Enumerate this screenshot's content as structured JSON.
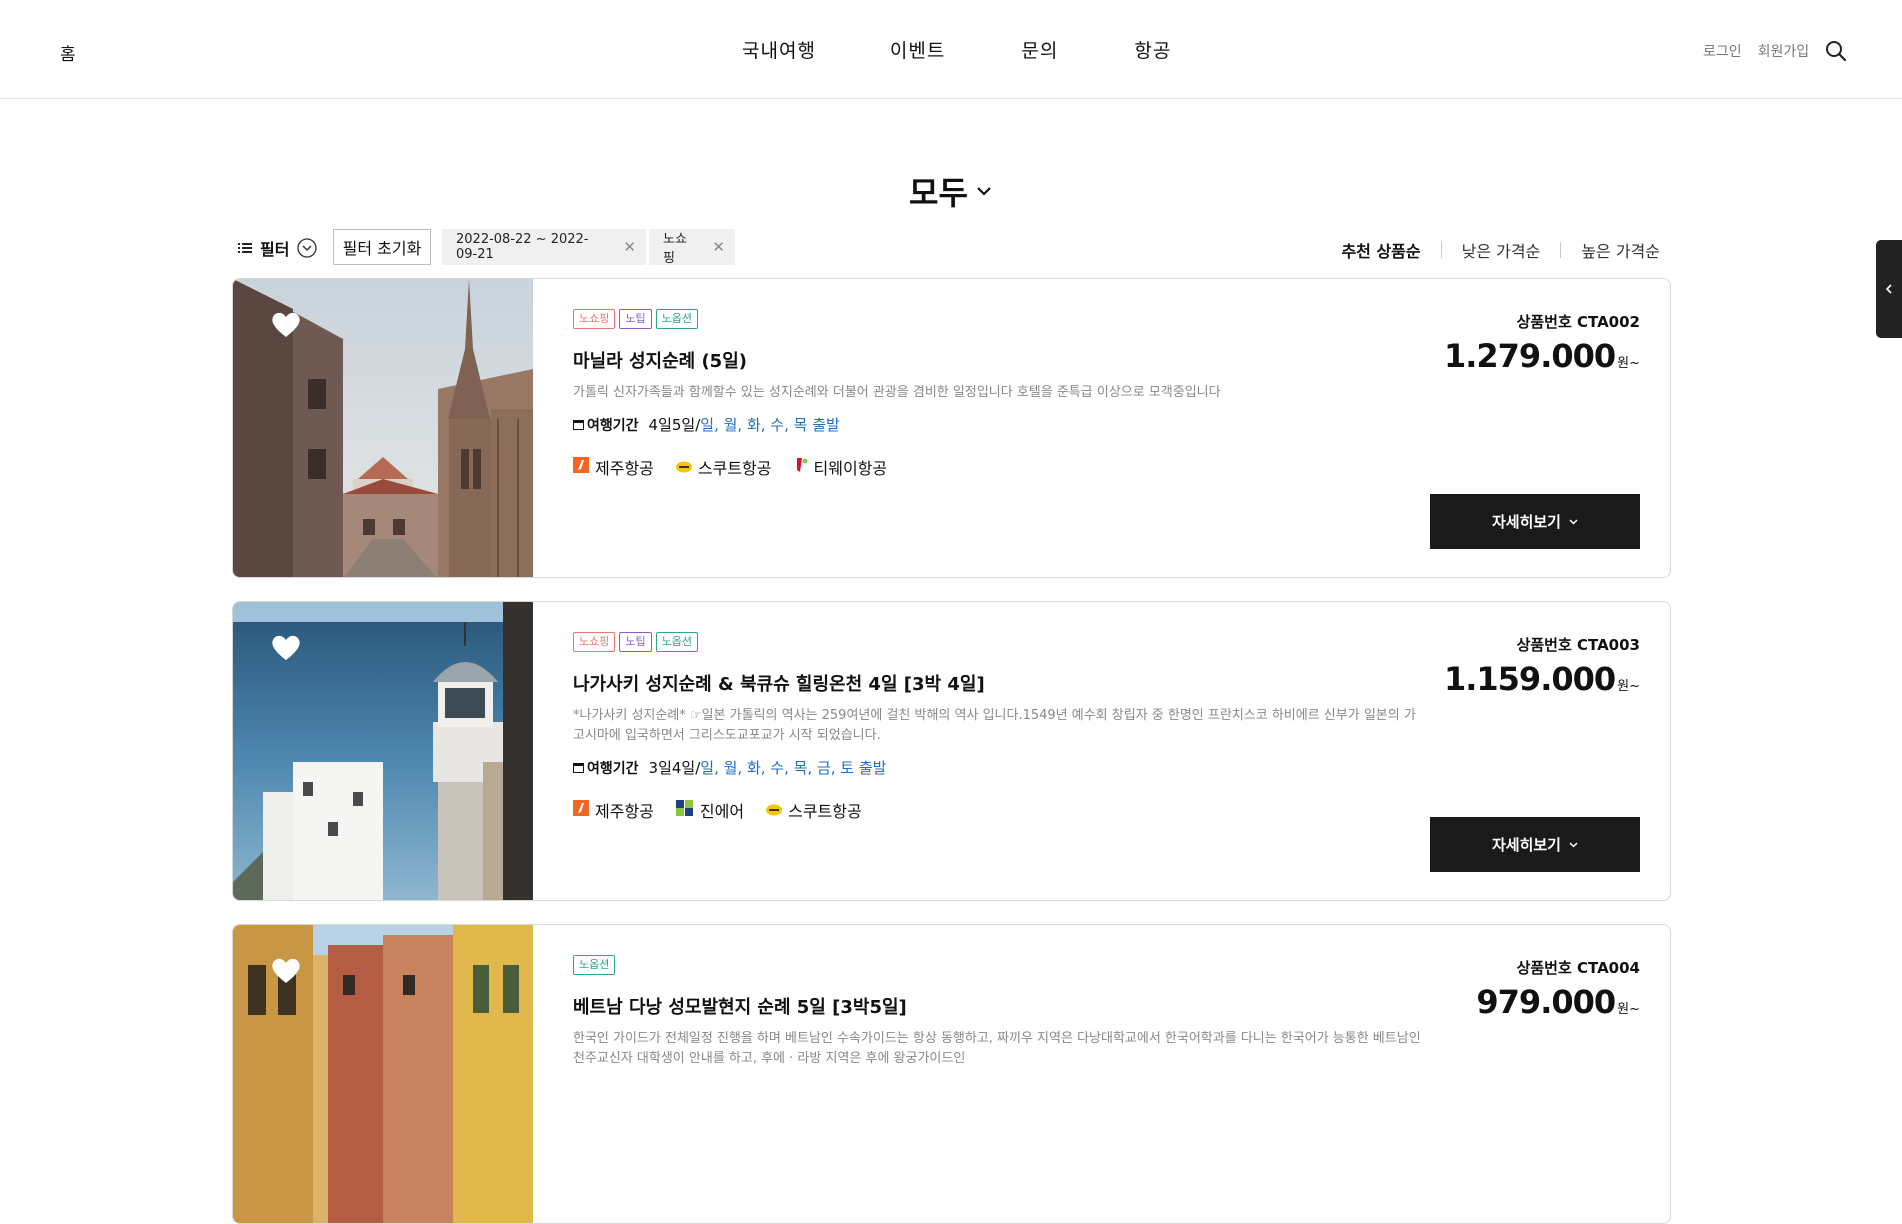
{
  "header": {
    "home": "홈",
    "nav": [
      "국내여행",
      "이벤트",
      "문의",
      "항공"
    ],
    "login": "로그인",
    "join": "회원가입"
  },
  "category": {
    "title": "모두"
  },
  "filters": {
    "toggle_label": "필터",
    "reset_label": "필터 초기화",
    "chips": [
      "2022-08-22 ~ 2022-09-21",
      "노쇼핑"
    ],
    "sort": [
      "추천 상품순",
      "낮은 가격순",
      "높은 가격순"
    ],
    "sort_active": "추천 상품순"
  },
  "products": [
    {
      "tags": [
        "노쇼핑",
        "노팁",
        "노옵션"
      ],
      "title": "마닐라 성지순례 (5일)",
      "description": "가톨릭 신자가족들과 함께할수 있는 성지순례와 더불어 관광을 겸비한 일정입니다 호텔을 준특급 이상으로 모객중입니다",
      "period_label": "여행기간",
      "period_value": "4일5일/",
      "period_days": "일, 월, 화, 수, 목 출발",
      "airlines": [
        "제주항공",
        "스쿠트항공",
        "티웨이항공"
      ],
      "code": "상품번호 CTA002",
      "price": "1.279.000",
      "price_unit": "원~",
      "detail_label": "자세히보기"
    },
    {
      "tags": [
        "노쇼핑",
        "노팁",
        "노옵션"
      ],
      "title": "나가사키 성지순례 & 북큐슈 힐링온천 4일 [3박 4일]",
      "description": "*나가사키 성지순례* ☞일본 가톨릭의 역사는 259여년에 걸친 박해의 역사 입니다.1549년 예수회 창립자 중 한명인 프란치스코 하비에르 신부가 일본의 가고시마에 입국하면서 그리스도교포교가 시작 되었습니다.",
      "period_label": "여행기간",
      "period_value": "3일4일/",
      "period_days": "일, 월, 화, 수, 목, 금, 토 출발",
      "airlines": [
        "제주항공",
        "진에어",
        "스쿠트항공"
      ],
      "code": "상품번호 CTA003",
      "price": "1.159.000",
      "price_unit": "원~",
      "detail_label": "자세히보기"
    },
    {
      "tags": [
        "노옵션"
      ],
      "title": "베트남 다낭 성모발현지 순례 5일 [3박5일]",
      "description": "한국인 가이드가 전체일정 진행을 하며 베트남인 수속가이드는 항상 동행하고, 짜끼우 지역은 다낭대학교에서 한국어학과를 다니는 한국어가 능통한 베트남인 천주교신자 대학생이 안내를 하고, 후에 · 라방 지역은 후에 왕궁가이드인",
      "code": "상품번호 CTA004",
      "price": "979.000",
      "price_unit": "원~"
    }
  ]
}
